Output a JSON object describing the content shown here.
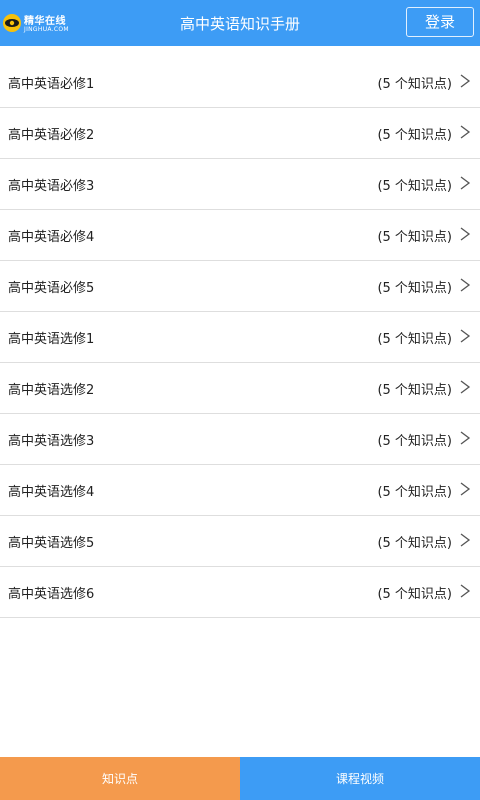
{
  "header": {
    "logo_text": "精华在线",
    "logo_sub": "JINGHUA.COM",
    "title": "高中英语知识手册",
    "login_label": "登录"
  },
  "list": {
    "items": [
      {
        "label": "高中英语必修1",
        "count": "(5 个知识点)"
      },
      {
        "label": "高中英语必修2",
        "count": "(5 个知识点)"
      },
      {
        "label": "高中英语必修3",
        "count": "(5 个知识点)"
      },
      {
        "label": "高中英语必修4",
        "count": "(5 个知识点)"
      },
      {
        "label": "高中英语必修5",
        "count": "(5 个知识点)"
      },
      {
        "label": "高中英语选修1",
        "count": "(5 个知识点)"
      },
      {
        "label": "高中英语选修2",
        "count": "(5 个知识点)"
      },
      {
        "label": "高中英语选修3",
        "count": "(5 个知识点)"
      },
      {
        "label": "高中英语选修4",
        "count": "(5 个知识点)"
      },
      {
        "label": "高中英语选修5",
        "count": "(5 个知识点)"
      },
      {
        "label": "高中英语选修6",
        "count": "(5 个知识点)"
      }
    ]
  },
  "tabs": {
    "knowledge_label": "知识点",
    "video_label": "课程视频"
  },
  "colors": {
    "header_bg": "#3d9cf5",
    "tab_active_bg": "#f49a4d",
    "tab_inactive_bg": "#3d9cf5"
  },
  "icons": {
    "logo": "logo-eye-icon",
    "row_chevron": "chevron-right-icon"
  }
}
